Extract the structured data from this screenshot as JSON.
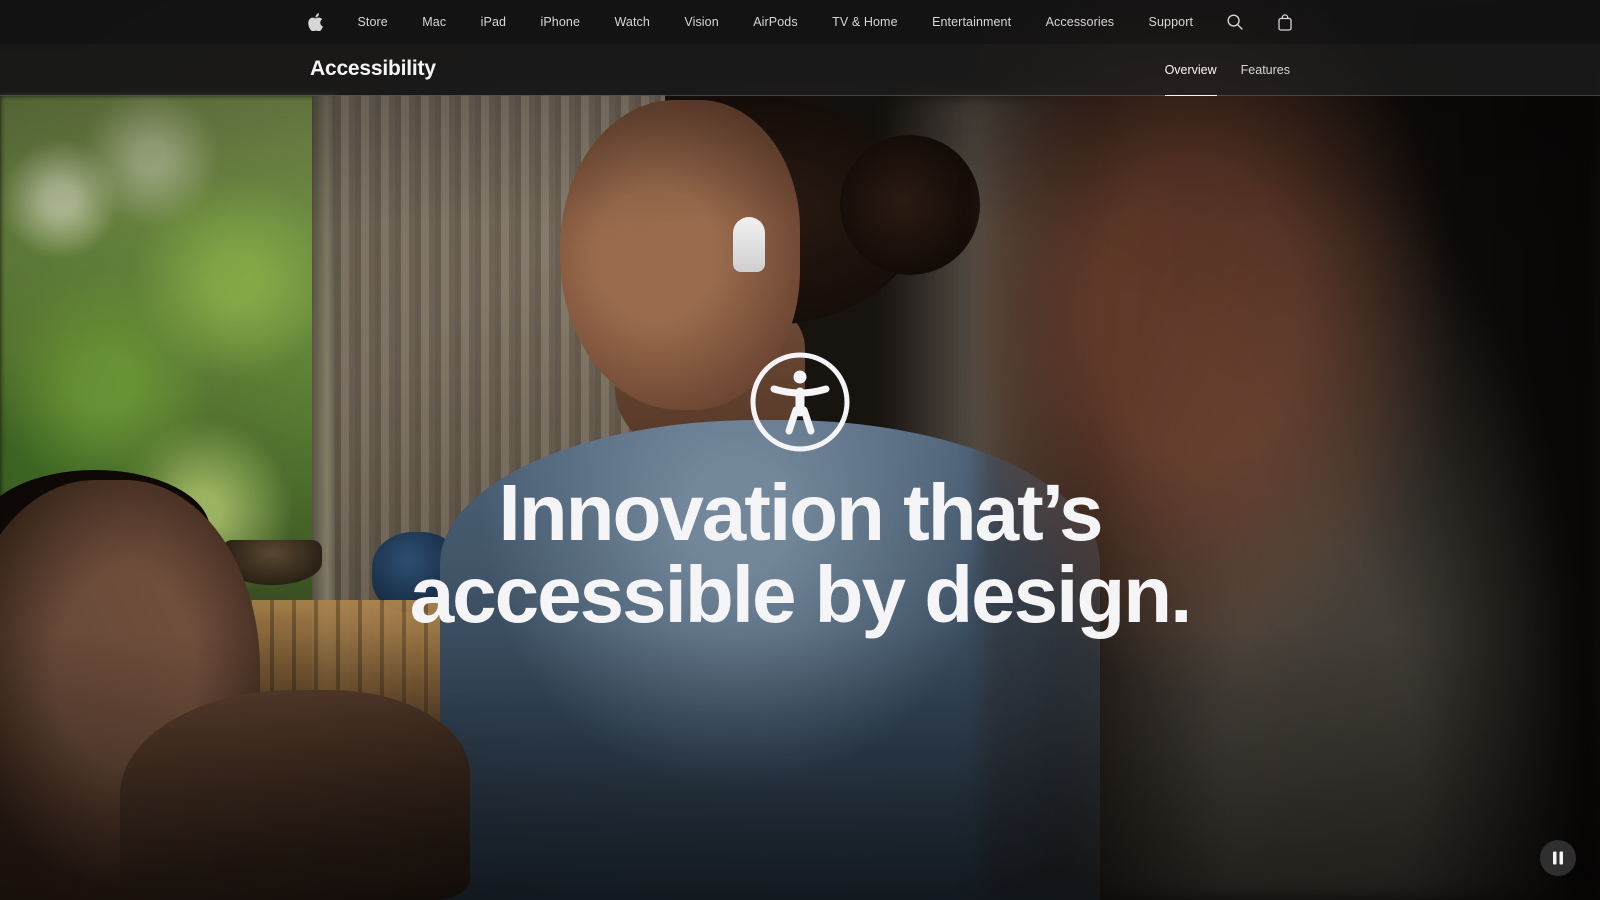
{
  "globalnav": {
    "apple_logo_icon": "apple-logo-icon",
    "items": [
      {
        "label": "Store"
      },
      {
        "label": "Mac"
      },
      {
        "label": "iPad"
      },
      {
        "label": "iPhone"
      },
      {
        "label": "Watch"
      },
      {
        "label": "Vision"
      },
      {
        "label": "AirPods"
      },
      {
        "label": "TV & Home"
      },
      {
        "label": "Entertainment"
      },
      {
        "label": "Accessories"
      },
      {
        "label": "Support"
      }
    ],
    "search_icon": "search-icon",
    "bag_icon": "shopping-bag-icon"
  },
  "localnav": {
    "title": "Accessibility",
    "links": [
      {
        "label": "Overview",
        "current": true
      },
      {
        "label": "Features",
        "current": false
      }
    ]
  },
  "hero": {
    "icon": "accessibility-icon",
    "headline_line1": "Innovation that’s",
    "headline_line2": "accessible by design."
  },
  "media_controls": {
    "pause_icon": "pause-icon"
  },
  "colors": {
    "nav_background": "#161617",
    "nav_text": "#d6d6d6",
    "headline_text": "#f5f5f7"
  }
}
